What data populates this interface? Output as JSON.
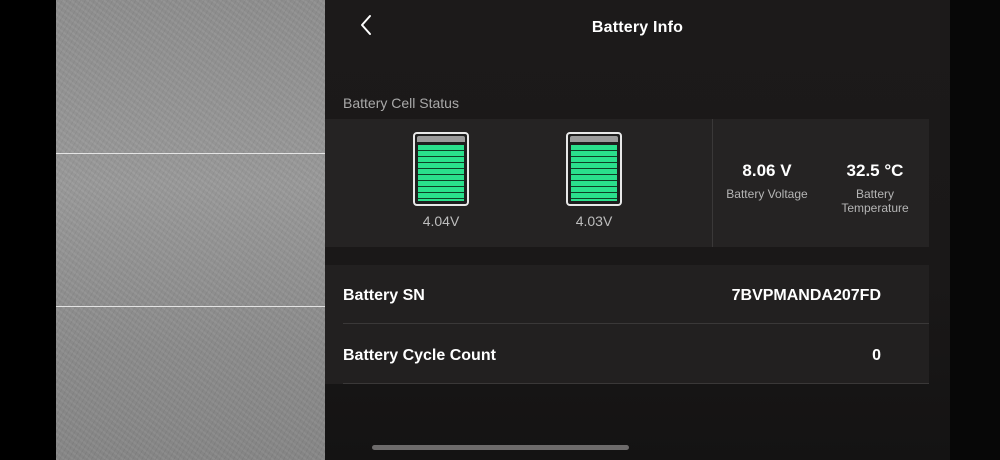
{
  "header": {
    "title": "Battery Info",
    "back_icon": "chevron-left-icon"
  },
  "cell_status": {
    "section_label": "Battery Cell Status",
    "cells": [
      {
        "voltage": "4.04V",
        "level_fraction": 1.0
      },
      {
        "voltage": "4.03V",
        "level_fraction": 1.0
      }
    ],
    "battery_voltage": {
      "value": "8.06 V",
      "label": "Battery Voltage"
    },
    "battery_temperature": {
      "value": "32.5 °C",
      "label_line1": "Battery",
      "label_line2": "Temperature"
    }
  },
  "info": {
    "serial": {
      "label": "Battery SN",
      "value": "7BVPMANDA207FD"
    },
    "cycle_count": {
      "label": "Battery Cycle Count",
      "value": "0"
    }
  },
  "colors": {
    "cell_fill": "#2ae08c",
    "panel_bg": "#1c1a1a",
    "card_bg": "#252323"
  }
}
